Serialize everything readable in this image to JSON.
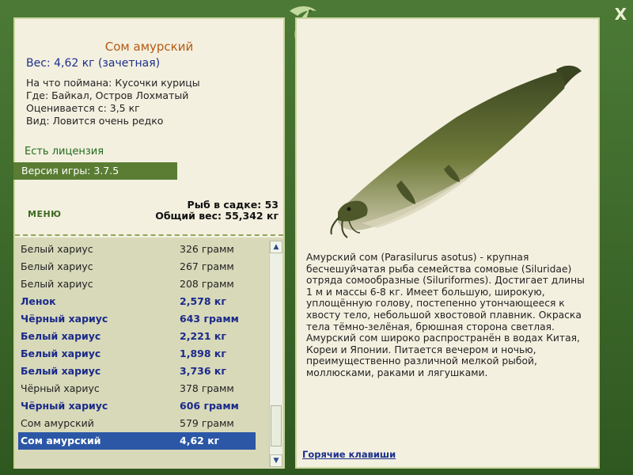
{
  "app": {
    "close_label": "X"
  },
  "fish_card": {
    "title": "Сом амурский",
    "weight": "Вес: 4,62 кг (зачетная)",
    "caught_on": "На что поймана: Кусочки курицы",
    "location": "Где: Байкал, Остров Лохматый",
    "valued_from": "Оценивается с: 3,5 кг",
    "kind": "Вид: Ловится очень редко",
    "license": "Есть лицензия",
    "version": "Версия игры: 3.7.5"
  },
  "menu": {
    "label": "МЕНЮ"
  },
  "stats": {
    "fish_in_net": "Рыб в садке: 53",
    "total_weight": "Общий вес: 55,342 кг"
  },
  "catch_list": [
    {
      "name": "Белый хариус",
      "weight": "326 грамм",
      "bold": false,
      "selected": false
    },
    {
      "name": "Белый хариус",
      "weight": "267 грамм",
      "bold": false,
      "selected": false
    },
    {
      "name": "Белый хариус",
      "weight": "208 грамм",
      "bold": false,
      "selected": false
    },
    {
      "name": "Ленок",
      "weight": "2,578 кг",
      "bold": true,
      "selected": false
    },
    {
      "name": "Чёрный хариус",
      "weight": "643 грамм",
      "bold": true,
      "selected": false
    },
    {
      "name": "Белый хариус",
      "weight": "2,221 кг",
      "bold": true,
      "selected": false
    },
    {
      "name": "Белый хариус",
      "weight": "1,898 кг",
      "bold": true,
      "selected": false
    },
    {
      "name": "Белый хариус",
      "weight": "3,736 кг",
      "bold": true,
      "selected": false
    },
    {
      "name": "Чёрный хариус",
      "weight": "378 грамм",
      "bold": false,
      "selected": false
    },
    {
      "name": "Чёрный хариус",
      "weight": "606 грамм",
      "bold": true,
      "selected": false
    },
    {
      "name": "Сом амурский",
      "weight": "579 грамм",
      "bold": false,
      "selected": false
    },
    {
      "name": "Сом амурский",
      "weight": "4,62 кг",
      "bold": true,
      "selected": true
    }
  ],
  "description": "Амурский сом (Parasilurus asotus) - крупная бесчешуйчатая рыба семейства сомовые (Siluridae) отряда сомообразные (Siluriformes). Достигает длины 1 м и массы 6-8 кг. Имеет большую, широкую, уплощённую голову, постепенно утончающееся к хвосту тело, небольшой хвостовой плавник. Окраска тела тёмно-зелёная, брюшная сторона светлая. Амурский сом широко распространён в водах Китая, Кореи и Японии. Питается вечером и ночью, преимущественно различной мелкой рыбой, моллюсками, раками и лягушками.",
  "hotkeys_label": "Горячие клавиши",
  "icons": {
    "close": "close-icon",
    "logo": "fish-logo-icon",
    "scroll_up": "chevron-up-icon",
    "scroll_down": "chevron-down-icon"
  },
  "colors": {
    "frame": "#3e6a2c",
    "panel": "#f4f0e0",
    "title": "#b45a12",
    "selection": "#2b57a6",
    "version_bar": "#5a7d33"
  }
}
